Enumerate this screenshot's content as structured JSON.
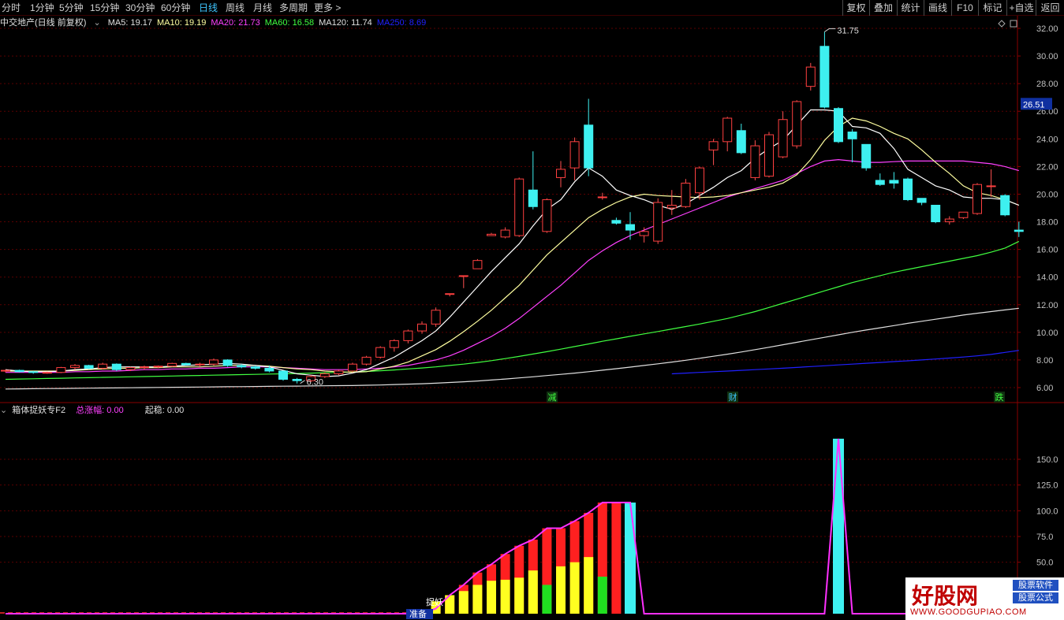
{
  "toolbar": {
    "periods": [
      {
        "label": "分时",
        "active": false
      },
      {
        "label": "1分钟",
        "active": false
      },
      {
        "label": "5分钟",
        "active": false
      },
      {
        "label": "15分钟",
        "active": false
      },
      {
        "label": "30分钟",
        "active": false
      },
      {
        "label": "60分钟",
        "active": false
      },
      {
        "label": "日线",
        "active": true
      },
      {
        "label": "周线",
        "active": false
      },
      {
        "label": "月线",
        "active": false
      },
      {
        "label": "多周期",
        "active": false
      },
      {
        "label": "更多 >",
        "active": false
      }
    ],
    "right_buttons": [
      "复权",
      "叠加",
      "统计",
      "画线",
      "F10",
      "标记",
      "+自选",
      "返回"
    ]
  },
  "main_chart": {
    "stock_title": "中交地产(日线 前复权)",
    "ma_legend": [
      {
        "label": "MA5: 19.17",
        "color": "#e0e0e0"
      },
      {
        "label": "MA10: 19.19",
        "color": "#ffffa0"
      },
      {
        "label": "MA20: 21.73",
        "color": "#ff40ff"
      },
      {
        "label": "MA60: 16.58",
        "color": "#40ff40"
      },
      {
        "label": "MA120: 11.74",
        "color": "#e0e0e0"
      },
      {
        "label": "MA250: 8.69",
        "color": "#2020ff"
      }
    ],
    "price_axis": [
      "32.00",
      "30.00",
      "28.00",
      "26.00",
      "24.00",
      "22.00",
      "20.00",
      "18.00",
      "16.00",
      "14.00",
      "12.00",
      "10.00",
      "8.00",
      "6.00"
    ],
    "current_price_tag": "26.51",
    "high_annotation": "31.75",
    "low_annotation": "6.30",
    "signal_labels": [
      {
        "text": "减",
        "color": "#40ff40"
      },
      {
        "text": "财",
        "color": "#3ec6ff"
      },
      {
        "text": "跌",
        "color": "#40ff40"
      }
    ]
  },
  "indicator": {
    "title": "箱体捉妖专F2",
    "total_gain_label": "总涨幅: 0.00",
    "rise_label": "起稳: 0.00",
    "axis": [
      "150.0",
      "125.0",
      "100.0",
      "75.0",
      "50.0"
    ],
    "bar_labels": [
      "捉妖",
      "准备"
    ]
  },
  "watermark": {
    "brand": "好股网",
    "tag1": "股票软件",
    "tag2": "股票公式",
    "url": "WWW.GOODGUPIAO.COM"
  },
  "chart_data": {
    "type": "candlestick",
    "y_range": [
      5.5,
      32.8
    ],
    "candles": [
      [
        7.2,
        7.3,
        7.1,
        7.25
      ],
      [
        7.25,
        7.3,
        7.1,
        7.15
      ],
      [
        7.15,
        7.2,
        7.0,
        7.1
      ],
      [
        7.1,
        7.15,
        7.0,
        7.1
      ],
      [
        7.1,
        7.5,
        7.05,
        7.45
      ],
      [
        7.45,
        7.7,
        7.3,
        7.6
      ],
      [
        7.6,
        7.65,
        7.35,
        7.4
      ],
      [
        7.4,
        7.8,
        7.3,
        7.7
      ],
      [
        7.7,
        7.75,
        7.2,
        7.3
      ],
      [
        7.3,
        7.5,
        7.2,
        7.45
      ],
      [
        7.45,
        7.6,
        7.3,
        7.5
      ],
      [
        7.5,
        7.6,
        7.4,
        7.55
      ],
      [
        7.55,
        7.8,
        7.5,
        7.75
      ],
      [
        7.75,
        7.8,
        7.6,
        7.65
      ],
      [
        7.65,
        7.8,
        7.5,
        7.7
      ],
      [
        7.7,
        8.1,
        7.6,
        8.0
      ],
      [
        8.0,
        8.05,
        7.5,
        7.6
      ],
      [
        7.6,
        7.7,
        7.4,
        7.5
      ],
      [
        7.5,
        7.6,
        7.3,
        7.4
      ],
      [
        7.4,
        7.6,
        7.1,
        7.2
      ],
      [
        7.2,
        7.2,
        6.5,
        6.6
      ],
      [
        6.6,
        6.7,
        6.3,
        6.5
      ],
      [
        6.5,
        6.9,
        6.4,
        6.8
      ],
      [
        6.8,
        7.1,
        6.7,
        7.0
      ],
      [
        7.0,
        7.3,
        6.9,
        7.2
      ],
      [
        7.2,
        7.8,
        7.1,
        7.7
      ],
      [
        7.7,
        8.3,
        7.6,
        8.2
      ],
      [
        8.2,
        9.0,
        8.1,
        8.9
      ],
      [
        8.9,
        9.5,
        8.6,
        9.4
      ],
      [
        9.4,
        10.2,
        9.2,
        10.1
      ],
      [
        10.1,
        10.8,
        9.9,
        10.6
      ],
      [
        10.6,
        11.8,
        10.4,
        11.6
      ],
      [
        12.8,
        12.8,
        12.6,
        12.8
      ],
      [
        14.1,
        14.1,
        13.2,
        14.1
      ],
      [
        14.6,
        15.3,
        14.6,
        15.2
      ],
      [
        17.0,
        17.2,
        17.0,
        17.1
      ],
      [
        16.9,
        17.6,
        16.8,
        17.4
      ],
      [
        17.0,
        21.2,
        16.9,
        21.1
      ],
      [
        20.3,
        23.1,
        18.9,
        19.1
      ],
      [
        17.3,
        19.7,
        17.2,
        19.6
      ],
      [
        21.2,
        22.4,
        20.5,
        21.8
      ],
      [
        21.9,
        24.1,
        21.0,
        23.8
      ],
      [
        25.0,
        26.9,
        21.3,
        21.9
      ],
      [
        19.8,
        20.1,
        19.6,
        19.8
      ],
      [
        18.1,
        18.3,
        17.8,
        17.9
      ],
      [
        17.8,
        18.7,
        16.7,
        17.4
      ],
      [
        17.0,
        17.6,
        16.5,
        17.3
      ],
      [
        16.6,
        19.7,
        16.4,
        19.4
      ],
      [
        19.0,
        20.3,
        18.5,
        19.2
      ],
      [
        19.1,
        21.1,
        19.0,
        20.8
      ],
      [
        20.1,
        22.0,
        19.6,
        21.9
      ],
      [
        23.2,
        24.0,
        22.1,
        23.8
      ],
      [
        23.8,
        25.6,
        23.1,
        25.5
      ],
      [
        24.6,
        25.1,
        22.9,
        23.0
      ],
      [
        21.2,
        23.9,
        21.0,
        23.5
      ],
      [
        21.3,
        24.5,
        21.2,
        24.3
      ],
      [
        22.7,
        26.0,
        22.6,
        25.4
      ],
      [
        23.5,
        26.8,
        23.3,
        26.7
      ],
      [
        27.8,
        29.5,
        27.5,
        29.2
      ],
      [
        30.7,
        31.75,
        26.2,
        26.3
      ],
      [
        26.2,
        26.3,
        23.7,
        23.8
      ],
      [
        24.5,
        24.7,
        22.3,
        24.0
      ],
      [
        23.6,
        23.6,
        21.7,
        21.9
      ],
      [
        21.0,
        21.5,
        20.6,
        20.7
      ],
      [
        21.0,
        21.6,
        20.4,
        20.8
      ],
      [
        21.1,
        21.2,
        19.5,
        19.6
      ],
      [
        19.7,
        19.7,
        19.2,
        19.4
      ],
      [
        19.2,
        19.2,
        17.9,
        18.0
      ],
      [
        18.0,
        18.4,
        17.8,
        18.2
      ],
      [
        18.3,
        18.7,
        18.2,
        18.7
      ],
      [
        18.6,
        20.8,
        18.5,
        20.7
      ],
      [
        20.6,
        21.8,
        19.8,
        20.6
      ],
      [
        19.9,
        20.0,
        18.4,
        18.5
      ],
      [
        17.4,
        18.0,
        16.9,
        17.3
      ]
    ],
    "ma5": [
      7.3,
      7.2,
      7.15,
      7.15,
      7.2,
      7.3,
      7.35,
      7.45,
      7.5,
      7.5,
      7.5,
      7.5,
      7.55,
      7.6,
      7.65,
      7.7,
      7.75,
      7.7,
      7.6,
      7.5,
      7.25,
      7.0,
      6.9,
      6.8,
      6.85,
      7.05,
      7.3,
      7.75,
      8.2,
      8.8,
      9.4,
      10.1,
      11.1,
      12.2,
      13.3,
      14.4,
      15.4,
      16.4,
      17.7,
      18.9,
      19.6,
      20.9,
      21.9,
      21.3,
      20.3,
      19.9,
      19.6,
      19.2,
      18.9,
      19.3,
      19.9,
      20.5,
      21.2,
      21.7,
      22.6,
      23.3,
      23.9,
      25.0,
      26.1,
      26.1,
      26.0,
      24.9,
      24.8,
      24.4,
      23.3,
      21.8,
      21.2,
      20.6,
      20.3,
      19.8,
      19.7,
      19.7,
      19.6,
      19.2
    ],
    "ma10": [
      7.2,
      7.2,
      7.2,
      7.2,
      7.2,
      7.25,
      7.3,
      7.35,
      7.4,
      7.4,
      7.45,
      7.45,
      7.5,
      7.5,
      7.5,
      7.55,
      7.6,
      7.6,
      7.6,
      7.55,
      7.45,
      7.35,
      7.3,
      7.2,
      7.15,
      7.1,
      7.15,
      7.35,
      7.55,
      7.85,
      8.3,
      8.75,
      9.35,
      10.05,
      10.8,
      11.6,
      12.5,
      13.4,
      14.5,
      15.6,
      16.5,
      17.4,
      18.3,
      18.9,
      19.4,
      19.8,
      20.0,
      19.9,
      19.85,
      19.8,
      19.75,
      19.8,
      19.9,
      20.1,
      20.3,
      20.5,
      20.8,
      21.4,
      22.5,
      23.9,
      24.9,
      25.5,
      25.3,
      24.9,
      24.4,
      24.0,
      23.2,
      22.3,
      21.5,
      20.6,
      20.1,
      19.9,
      19.6,
      19.2
    ],
    "ma20": [
      7.1,
      7.1,
      7.1,
      7.1,
      7.1,
      7.15,
      7.15,
      7.2,
      7.2,
      7.25,
      7.3,
      7.3,
      7.35,
      7.35,
      7.4,
      7.4,
      7.45,
      7.5,
      7.5,
      7.5,
      7.45,
      7.4,
      7.35,
      7.3,
      7.3,
      7.3,
      7.35,
      7.4,
      7.5,
      7.6,
      7.8,
      8.0,
      8.3,
      8.7,
      9.2,
      9.7,
      10.3,
      11.0,
      11.8,
      12.6,
      13.4,
      14.3,
      15.2,
      15.9,
      16.5,
      17.0,
      17.4,
      17.8,
      18.2,
      18.6,
      19.0,
      19.4,
      19.8,
      20.1,
      20.4,
      20.7,
      21.0,
      21.5,
      22.0,
      22.4,
      22.5,
      22.4,
      22.3,
      22.3,
      22.35,
      22.4,
      22.4,
      22.4,
      22.4,
      22.4,
      22.3,
      22.2,
      22.0,
      21.7
    ],
    "ma60": [
      6.6,
      6.62,
      6.64,
      6.66,
      6.68,
      6.7,
      6.72,
      6.74,
      6.76,
      6.78,
      6.8,
      6.82,
      6.84,
      6.86,
      6.88,
      6.9,
      6.92,
      6.94,
      6.96,
      6.98,
      7.0,
      7.02,
      7.05,
      7.08,
      7.1,
      7.13,
      7.17,
      7.22,
      7.28,
      7.35,
      7.42,
      7.5,
      7.6,
      7.7,
      7.82,
      7.95,
      8.1,
      8.26,
      8.43,
      8.6,
      8.78,
      8.97,
      9.16,
      9.35,
      9.53,
      9.71,
      9.89,
      10.06,
      10.24,
      10.42,
      10.6,
      10.8,
      11.0,
      11.25,
      11.5,
      11.8,
      12.1,
      12.4,
      12.7,
      13.0,
      13.3,
      13.6,
      13.85,
      14.1,
      14.35,
      14.55,
      14.75,
      14.95,
      15.15,
      15.35,
      15.55,
      15.8,
      16.1,
      16.58
    ],
    "ma120": [
      5.9,
      5.91,
      5.92,
      5.93,
      5.94,
      5.95,
      5.96,
      5.97,
      5.98,
      5.99,
      6.0,
      6.01,
      6.02,
      6.03,
      6.04,
      6.05,
      6.06,
      6.07,
      6.08,
      6.09,
      6.1,
      6.11,
      6.12,
      6.13,
      6.14,
      6.15,
      6.17,
      6.19,
      6.22,
      6.25,
      6.28,
      6.32,
      6.37,
      6.42,
      6.48,
      6.55,
      6.62,
      6.7,
      6.78,
      6.87,
      6.96,
      7.05,
      7.15,
      7.26,
      7.37,
      7.48,
      7.6,
      7.72,
      7.85,
      7.98,
      8.12,
      8.27,
      8.42,
      8.58,
      8.75,
      8.92,
      9.1,
      9.28,
      9.46,
      9.64,
      9.82,
      10.0,
      10.17,
      10.33,
      10.49,
      10.65,
      10.8,
      10.95,
      11.1,
      11.25,
      11.38,
      11.5,
      11.62,
      11.74
    ],
    "ma250": [
      null,
      null,
      null,
      null,
      null,
      null,
      null,
      null,
      null,
      null,
      null,
      null,
      null,
      null,
      null,
      null,
      null,
      null,
      null,
      null,
      null,
      null,
      null,
      null,
      null,
      null,
      null,
      null,
      null,
      null,
      null,
      null,
      null,
      null,
      null,
      null,
      null,
      null,
      null,
      null,
      null,
      null,
      null,
      null,
      null,
      null,
      null,
      null,
      7.0,
      7.05,
      7.1,
      7.15,
      7.2,
      7.25,
      7.3,
      7.35,
      7.4,
      7.46,
      7.52,
      7.58,
      7.64,
      7.7,
      7.76,
      7.82,
      7.88,
      7.94,
      8.0,
      8.07,
      8.14,
      8.21,
      8.3,
      8.4,
      8.55,
      8.69
    ],
    "indicator_y_range": [
      0,
      190
    ],
    "indicator_bars": [
      {
        "i": 31,
        "v": 5,
        "c": "#ff2020"
      },
      {
        "i": 32,
        "v": 18,
        "c": "#ff2020"
      },
      {
        "i": 33,
        "v": 28,
        "c": "#ff2020"
      },
      {
        "i": 34,
        "v": 40,
        "c": "#ff2020"
      },
      {
        "i": 35,
        "v": 48,
        "c": "#ff2020"
      },
      {
        "i": 36,
        "v": 58,
        "c": "#ff2020"
      },
      {
        "i": 37,
        "v": 66,
        "c": "#ff2020"
      },
      {
        "i": 38,
        "v": 72,
        "c": "#ff2020"
      },
      {
        "i": 39,
        "v": 83,
        "c": "#ff2020"
      },
      {
        "i": 40,
        "v": 83,
        "c": "#ff2020"
      },
      {
        "i": 41,
        "v": 90,
        "c": "#ff2020"
      },
      {
        "i": 42,
        "v": 98,
        "c": "#ff2020"
      },
      {
        "i": 43,
        "v": 108,
        "c": "#ff2020"
      },
      {
        "i": 44,
        "v": 108,
        "c": "#ff2020"
      },
      {
        "i": 45,
        "v": 108,
        "c": "#3ef0f0"
      },
      {
        "i": 60,
        "v": 170,
        "c": "#3ef0f0"
      }
    ],
    "indicator_inner_bars": [
      {
        "i": 31,
        "v": 12,
        "c": "#ffff20"
      },
      {
        "i": 32,
        "v": 18,
        "c": "#ffff20"
      },
      {
        "i": 33,
        "v": 22,
        "c": "#ffff20"
      },
      {
        "i": 34,
        "v": 28,
        "c": "#ffff20"
      },
      {
        "i": 35,
        "v": 32,
        "c": "#ffff20"
      },
      {
        "i": 36,
        "v": 33,
        "c": "#ffff20"
      },
      {
        "i": 37,
        "v": 35,
        "c": "#ffff20"
      },
      {
        "i": 38,
        "v": 42,
        "c": "#ffff20"
      },
      {
        "i": 39,
        "v": 28,
        "c": "#20e020"
      },
      {
        "i": 40,
        "v": 46,
        "c": "#ffff20"
      },
      {
        "i": 41,
        "v": 50,
        "c": "#ffff20"
      },
      {
        "i": 42,
        "v": 55,
        "c": "#ffff20"
      },
      {
        "i": 43,
        "v": 36,
        "c": "#20e020"
      }
    ]
  }
}
